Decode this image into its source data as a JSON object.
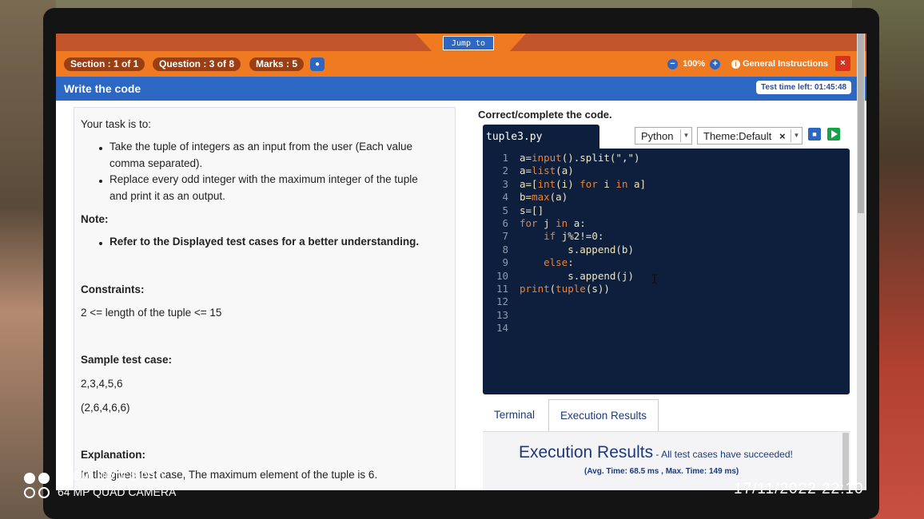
{
  "header": {
    "section": "Section : 1 of 1",
    "question": "Question : 3 of 8",
    "marks": "Marks : 5",
    "jump_to": "Jump to",
    "zoom": "100%",
    "general_instructions": "General Instructions",
    "close": "×"
  },
  "titlebar": {
    "title": "Write the code",
    "timer": "Test time left: 01:45:48"
  },
  "task": {
    "intro": "Your task is to:",
    "bullets": [
      "Take the tuple of integers as an input from the user (Each value",
      "comma separated).",
      "Replace every odd integer with the maximum integer of the tuple",
      "and print it as an output."
    ],
    "note_label": "Note:",
    "note_bullet": "Refer to the Displayed test cases for a better understanding.",
    "constraints_label": "Constraints:",
    "constraint": "2 <= length of the tuple <= 15",
    "sample_label": "Sample test case:",
    "sample_input": "2,3,4,5,6",
    "sample_output": "(2,6,4,6,6)",
    "explanation_label": "Explanation:",
    "explanation": "In the given test case, The maximum element of the tuple is 6."
  },
  "editor": {
    "heading": "Correct/complete the code.",
    "filename": "tuple3.py",
    "language": "Python",
    "theme": "Theme:Default",
    "theme_clear": "×",
    "lines": [
      {
        "n": "1",
        "text": "a=input().split(\",\")"
      },
      {
        "n": "2",
        "text": "a=list(a)"
      },
      {
        "n": "3",
        "text": "a=[int(i) for i in a]"
      },
      {
        "n": "4",
        "text": "b=max(a)"
      },
      {
        "n": "5",
        "text": "s=[]"
      },
      {
        "n": "6",
        "text": "for j in a:"
      },
      {
        "n": "7",
        "text": "    if j%2!=0:"
      },
      {
        "n": "8",
        "text": "        s.append(b)"
      },
      {
        "n": "9",
        "text": "    else:"
      },
      {
        "n": "10",
        "text": "        s.append(j)"
      },
      {
        "n": "11",
        "text": "print(tuple(s))"
      },
      {
        "n": "12",
        "text": ""
      },
      {
        "n": "13",
        "text": ""
      },
      {
        "n": "14",
        "text": ""
      }
    ]
  },
  "tabs": {
    "terminal": "Terminal",
    "execution_results": "Execution Results"
  },
  "results": {
    "heading": "Execution Results",
    "status": " - All test cases have succeeded!",
    "timing": "(Avg. Time: 68.5 ms , Max. Time: 149 ms)"
  },
  "photo": {
    "watermark_line1": "REDMI NOTE 8 PRO",
    "watermark_line2": "64 MP QUAD CAMERA",
    "timestamp": "17/11/2022 22:10"
  },
  "colors": {
    "orange": "#f07a22",
    "blue": "#2d67c4",
    "editor_bg": "#0d1f3c",
    "keyword": "#e8833a"
  }
}
